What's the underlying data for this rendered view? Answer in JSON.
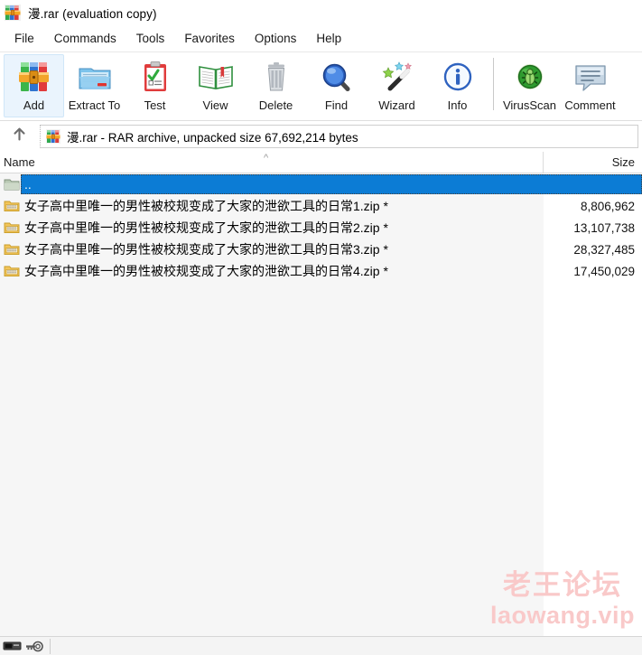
{
  "window": {
    "title": "漫.rar (evaluation copy)",
    "icon": "winrar-books-icon"
  },
  "menubar": {
    "items": [
      {
        "label": "File"
      },
      {
        "label": "Commands"
      },
      {
        "label": "Tools"
      },
      {
        "label": "Favorites"
      },
      {
        "label": "Options"
      },
      {
        "label": "Help"
      }
    ]
  },
  "toolbar": {
    "buttons": [
      {
        "label": "Add",
        "icon": "add-archive-icon",
        "active": true
      },
      {
        "label": "Extract To",
        "icon": "extract-folder-icon",
        "active": false
      },
      {
        "label": "Test",
        "icon": "test-clipboard-icon",
        "active": false
      },
      {
        "label": "View",
        "icon": "view-book-icon",
        "active": false
      },
      {
        "label": "Delete",
        "icon": "delete-trash-icon",
        "active": false
      },
      {
        "label": "Find",
        "icon": "find-magnifier-icon",
        "active": false
      },
      {
        "label": "Wizard",
        "icon": "wizard-wand-icon",
        "active": false
      },
      {
        "label": "Info",
        "icon": "info-circle-icon",
        "active": false
      },
      {
        "label": "VirusScan",
        "icon": "virusscan-bug-icon",
        "active": false
      },
      {
        "label": "Comment",
        "icon": "comment-bubble-icon",
        "active": false
      }
    ],
    "separator_before": "VirusScan"
  },
  "addressbar": {
    "up_icon": "up-arrow-icon",
    "archive_icon": "winrar-books-icon",
    "path_text": "漫.rar - RAR archive, unpacked size 67,692,214 bytes"
  },
  "columns": {
    "name_header": "Name",
    "size_header": "Size",
    "sort_caret": "^"
  },
  "filelist": {
    "rows": [
      {
        "name": "..",
        "size": "",
        "icon": "parent-folder-icon",
        "selected": true
      },
      {
        "name": "女子高中里唯一的男性被校规变成了大家的泄欲工具的日常1.zip *",
        "size": "8,806,962",
        "icon": "zip-archive-icon",
        "selected": false
      },
      {
        "name": "女子高中里唯一的男性被校规变成了大家的泄欲工具的日常2.zip *",
        "size": "13,107,738",
        "icon": "zip-archive-icon",
        "selected": false
      },
      {
        "name": "女子高中里唯一的男性被校规变成了大家的泄欲工具的日常3.zip *",
        "size": "28,327,485",
        "icon": "zip-archive-icon",
        "selected": false
      },
      {
        "name": "女子高中里唯一的男性被校规变成了大家的泄欲工具的日常4.zip *",
        "size": "17,450,029",
        "icon": "zip-archive-icon",
        "selected": false
      }
    ]
  },
  "watermark": {
    "line1": "老王论坛",
    "line2": "laowang.vip",
    "color": "#f9c9c9"
  },
  "statusbar": {
    "drive_icon": "drive-icon",
    "key_icon": "key-icon",
    "text": ""
  },
  "colors": {
    "selection": "#0c7cd5",
    "toolbar_active": "#eaf4fd",
    "list_left_bg": "#f6f6f6",
    "list_right_bg": "#ffffff"
  }
}
